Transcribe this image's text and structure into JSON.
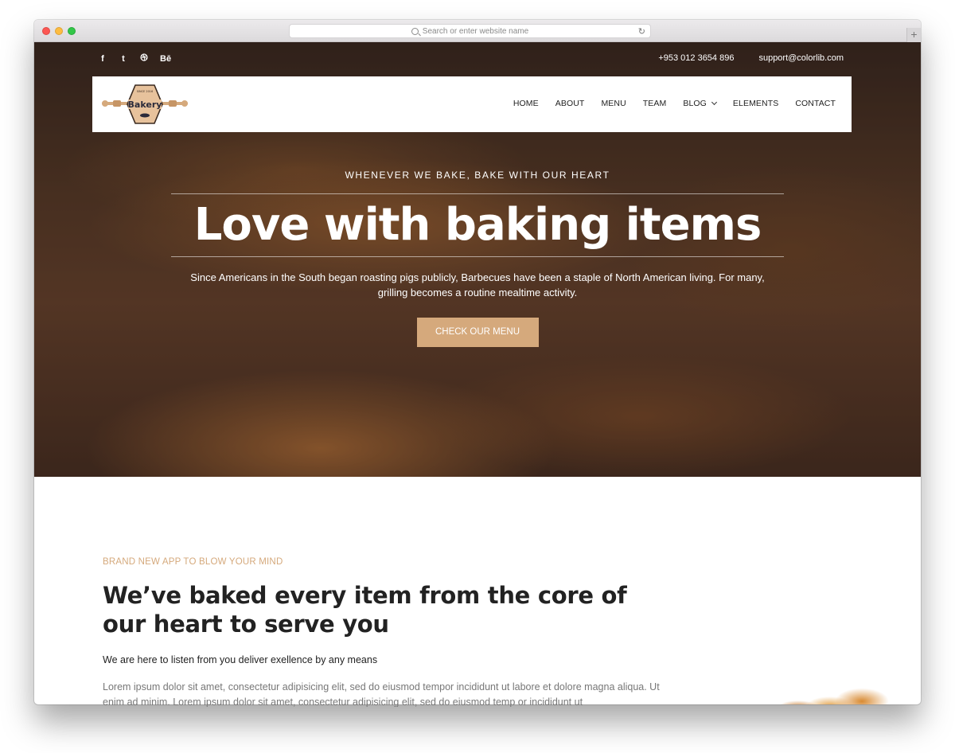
{
  "browser": {
    "address_placeholder": "Search or enter website name"
  },
  "topbar": {
    "social": [
      "f",
      "t",
      "d",
      "Bē"
    ],
    "phone": "+953 012 3654 896",
    "email": "support@colorlib.com"
  },
  "logo": {
    "top_text": "SINCE 2016",
    "name": "Bakery"
  },
  "nav": {
    "items": [
      "HOME",
      "ABOUT",
      "MENU",
      "TEAM",
      "BLOG",
      "ELEMENTS",
      "CONTACT"
    ]
  },
  "hero": {
    "eyebrow": "WHENEVER WE BAKE, BAKE WITH OUR HEART",
    "title": "Love with baking items",
    "description": "Since Americans in the South began roasting pigs publicly, Barbecues have been a staple of North American living. For many, grilling becomes a routine mealtime activity.",
    "cta": "CHECK OUR MENU"
  },
  "about": {
    "eyebrow": "BRAND NEW APP TO BLOW YOUR MIND",
    "title": "We’ve baked every item from the core of our heart to serve you",
    "subtitle": "We are here to listen from you deliver exellence by any means",
    "body": "Lorem ipsum dolor sit amet, consectetur adipisicing elit, sed do eiusmod tempor incididunt ut labore et dolore magna aliqua. Ut enim ad minim. Lorem ipsum dolor sit amet, consectetur adipisicing elit, sed do eiusmod temp or incididunt ut"
  },
  "colors": {
    "accent": "#d5a97c",
    "heading": "#222222",
    "body_text": "#777777"
  }
}
